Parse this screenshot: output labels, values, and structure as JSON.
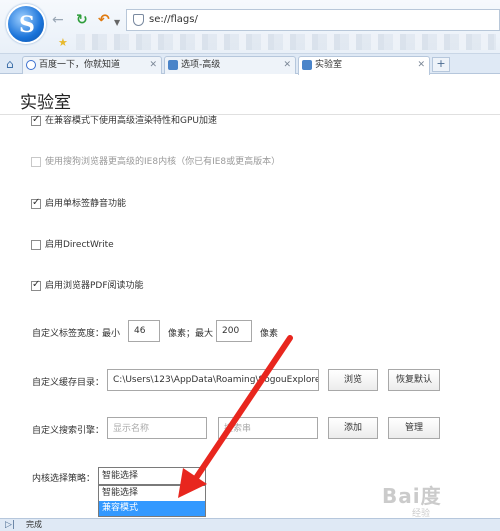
{
  "browser": {
    "logo_letter": "S",
    "address": "se://flags/",
    "tabs": [
      {
        "label": "百度一下，你就知道"
      },
      {
        "label": "选项-高级"
      },
      {
        "label": "实验室"
      }
    ],
    "new_tab": "+",
    "status": "完成"
  },
  "page": {
    "title": "实验室",
    "options": [
      {
        "label": "在兼容模式下使用高级渲染特性和GPU加速",
        "checked": true
      },
      {
        "label": "使用搜狗浏览器更高级的IE8内核（你已有IE8或更高版本）",
        "checked": false,
        "disabled": true
      },
      {
        "label": "启用单标签静音功能",
        "checked": true
      },
      {
        "label": "启用DirectWrite",
        "checked": false
      },
      {
        "label": "启用浏览器PDF阅读功能",
        "checked": true
      }
    ],
    "tab_width": {
      "label": "自定义标签宽度：",
      "min_label": "最小",
      "min_value": "46",
      "unit1": "像素；最大",
      "max_value": "200",
      "unit2": "像素"
    },
    "cache": {
      "label": "自定义缓存目录：",
      "value": "C:\\Users\\123\\AppData\\Roaming\\SogouExplorer\\",
      "browse": "浏览",
      "restore": "恢复默认"
    },
    "search": {
      "label": "自定义搜索引擎：",
      "name_placeholder": "显示名称",
      "url_placeholder": "搜索串",
      "add": "添加",
      "manage": "管理"
    },
    "engine": {
      "label": "内核选择策略：",
      "selected": "智能选择",
      "options": [
        "智能选择",
        "兼容模式"
      ]
    }
  },
  "watermark": {
    "brand": "Bai度",
    "sub": "经验"
  }
}
